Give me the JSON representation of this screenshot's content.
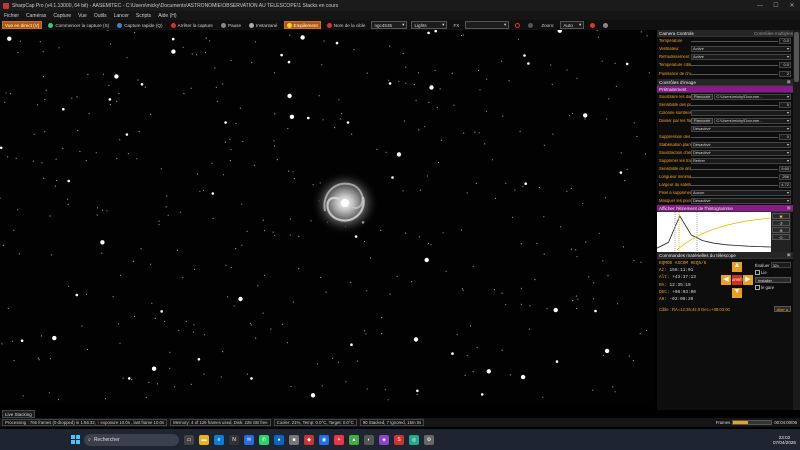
{
  "window": {
    "title": "SharpCap Pro (v4.1.13000, 64 bit) - AASEMITEC - C:\\Users\\micky\\Documents\\ASTRONOMIE\\OBSERVATION AU TELESCOPE\\1 Stacks en cours",
    "minimize": "—",
    "maximize": "☐",
    "close": "✕"
  },
  "menu": [
    "Fichier",
    "Caméras",
    "Capture",
    "Vue",
    "Outils",
    "Lancer",
    "Scripts",
    "Aide (H)"
  ],
  "toolbar": {
    "live_view": "Vue en direct (V)",
    "start_capture": "Commencer la capture (S)",
    "quick_capture": "Capture rapide (Q)",
    "stop_capture": "Arrêter la capture",
    "pause": "Pause",
    "snapshot": "Instantané",
    "stacking": "Empilement",
    "target_label": "Nom de la cible",
    "target_value": "ngc4535",
    "frame_type": "Lights",
    "fx_label": "FX",
    "fx_value": "",
    "zoom_label": "Zoom:",
    "zoom_value": "Auto"
  },
  "panel": {
    "camera_controls": "Camera Controls",
    "camera_controls_multiple": "Contrôles multiples",
    "temperature_label": "Température",
    "temperature_value": "0.0",
    "fan_label": "Ventilateur",
    "fan_value": "Activé",
    "cooling_label": "Refroidissement",
    "cooling_value": "Activé",
    "target_temp_label": "Température cible",
    "target_temp_value": "0.0",
    "dew_heater_label": "Puissance de chauffage de buées",
    "dew_heater_value": "2",
    "image_controls": "Contrôles d'image",
    "preprocessing": "Prétraitement",
    "subtract_dark_label": "Soustraire les darks",
    "browse": "Parcourir",
    "dark_path": "C:\\Users\\micky\\Docume...",
    "hot_pixel_label": "Sensibilité des pixels chauds",
    "hot_pixel_value": "5",
    "bad_col_label": "Colonne sombres supplémentaires",
    "bad_col_value": "",
    "flat_label": "Diviser par les flats",
    "flat_path": "C:\\Users\\micky\\Docume...",
    "flat_mode": "Désactivé",
    "band_label": "Suppression des bandes",
    "band_value": "0",
    "debayer_label": "Stabilisation planète / disque",
    "debayer_value": "Désactivé",
    "bayer_label": "Soustraction d'arrière-plan",
    "bayer_value": "Désactivé",
    "sat_label": "Supprimer les traces satellites",
    "sat_value": "Retirer",
    "sat_thresh_label": "Sensibilité de détection du satellite",
    "sat_thresh_value": "9.60",
    "sat_len_label": "Longueur minimale du satellite",
    "sat_len_value": "256",
    "sat_width_label": "Largeur du satellite",
    "sat_width_value": "4.72",
    "trails_label": "Pixel à supprimer autour du satellite",
    "trails_value": "Aucun",
    "mask_label": "Masquer les pixels saturés",
    "mask_value": "Désactivé",
    "histogram": "Afficher l'étirement de l'histogramme",
    "telescope": "Commandes matérielles du télescope",
    "mount_name": "EQMOD ASCOM HEQ5/6",
    "az_label": "Az:",
    "az_value": "156:11:01",
    "alt_label": "Alt:",
    "alt_value": "+43:37:13",
    "ra_label": "RA:",
    "ra_value": "12:35:19",
    "dec_label": "DEC:",
    "dec_value": "+08:03:00",
    "ah_label": "AH:",
    "ah_value": "-02:06:20",
    "slew_label": "Évaluer",
    "slew_speed": "32x",
    "track_label": "Lie",
    "install_btn": "Installer",
    "side_label": "le gare",
    "stop_btn": "ARRÊT",
    "tracking": "Actif",
    "park": "Aller à",
    "cible_label": "Cible : RA=12:35:42.0 Dec=+08:03:00",
    "sync": "Sync"
  },
  "live_tab": "Live Stacking",
  "status": {
    "processing": "Processing : 766 frames (0 dropped) in 1:56:32, ↑ exposure 10.0s , last frame 10.0s",
    "memory": "Memory: 4 of 129 frames used, Disk: 228 GB free",
    "cooler": "Cooler: 21%, Temp: 0.0°C, Target: 0.0°C",
    "stacked": "90 Stacked, 7 Ignored, 15m 0s",
    "frames_label": "Frames",
    "elapsed": "00:04:00/06"
  },
  "taskbar": {
    "search_placeholder": "Rechercher",
    "time": "23:02",
    "date": "07/04/2026"
  },
  "chart_data": {
    "type": "line",
    "x": [
      0,
      1,
      2,
      3,
      4,
      5,
      6,
      7,
      8,
      9,
      10
    ],
    "values": [
      5,
      20,
      90,
      40,
      25,
      18,
      14,
      12,
      10,
      9,
      8
    ]
  }
}
